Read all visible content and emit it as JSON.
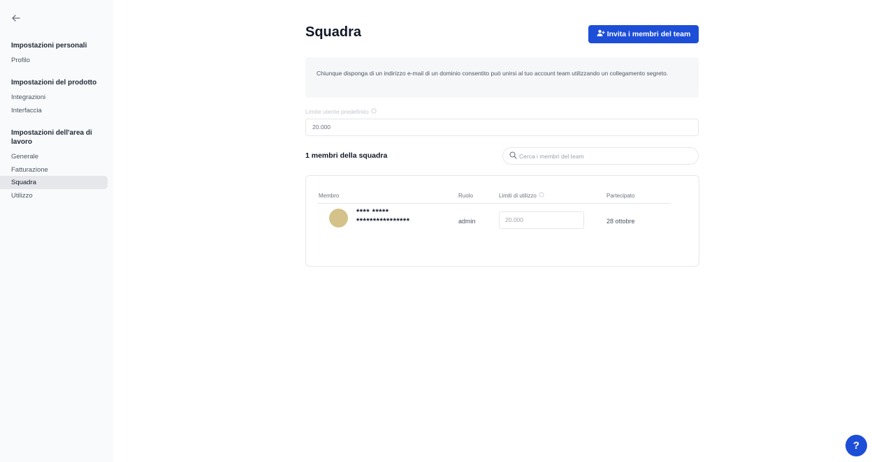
{
  "sidebar": {
    "sections": [
      {
        "title": "Impostazioni personali",
        "items": [
          "Profilo"
        ]
      },
      {
        "title": "Impostazioni del prodotto",
        "items": [
          "Integrazioni",
          "Interfaccia"
        ]
      },
      {
        "title": "Impostazioni dell'area di lavoro",
        "items": [
          "Generale",
          "Fatturazione",
          "Squadra",
          "Utilizzo"
        ]
      }
    ],
    "active_item": "Squadra"
  },
  "main": {
    "title": "Squadra",
    "invite_button": "Invita i membri del team",
    "info_text": "Chiunque disponga di un indirizzo e-mail di un dominio consentito può unirsi al tuo account team utilizzando un collegamento segreto.",
    "default_limit_label": "Limite utente predefinito",
    "default_limit_value": "20.000",
    "members_count": "1 membri della squadra",
    "search_placeholder": "Cerca i membri del team",
    "table": {
      "headers": [
        "Membro",
        "Ruolo",
        "Limiti di utilizzo",
        "Partecipato"
      ],
      "rows": [
        {
          "name": "**** *****",
          "email": "****************",
          "role": "admin",
          "limit": "20.000",
          "joined": "28 ottobre"
        }
      ]
    }
  },
  "help_button": "?",
  "colors": {
    "accent": "#1d4ed8",
    "sidebar_bg": "#f9fafb",
    "avatar": "#d4c28a"
  }
}
